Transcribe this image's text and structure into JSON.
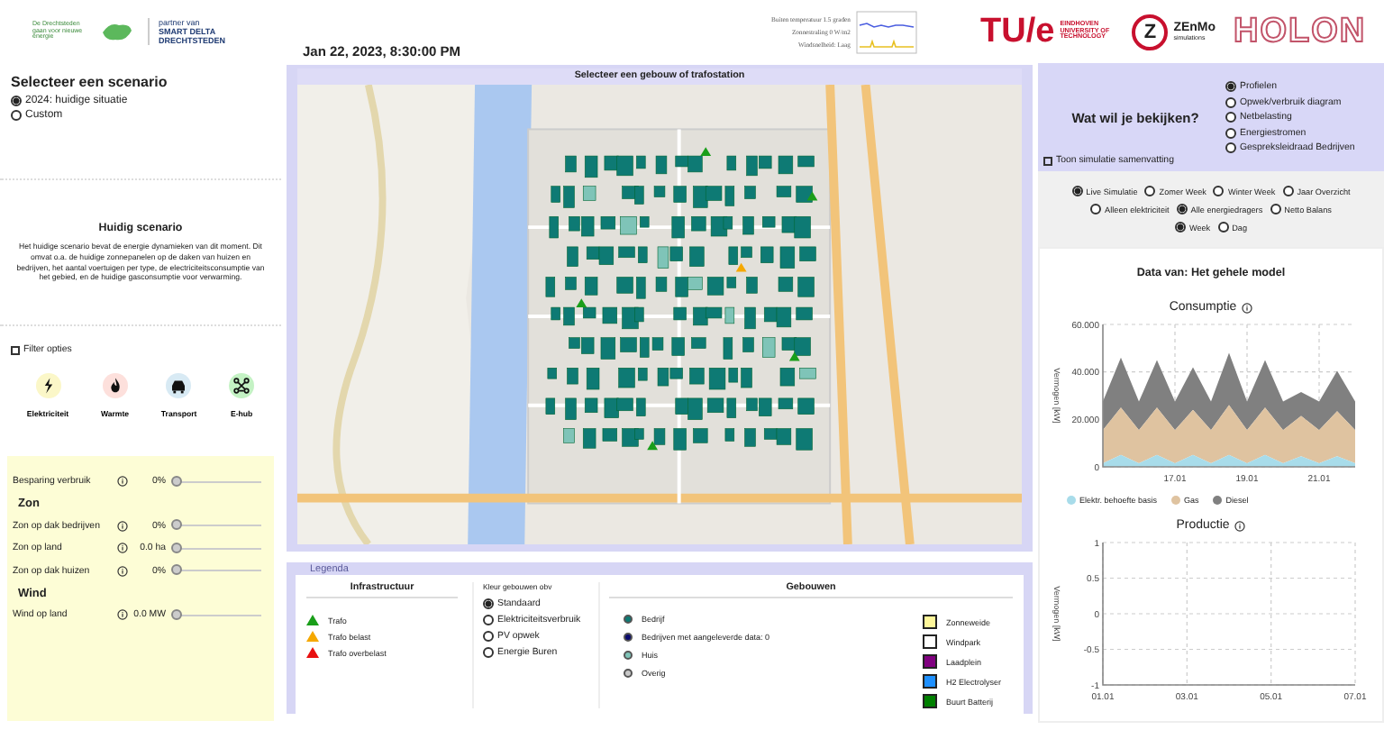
{
  "header": {
    "logo_left": "De Drechtsteden gaan voor nieuwe energie",
    "partner": {
      "caption": "partner van",
      "name": "SMART DELTA DRECHTSTEDEN"
    },
    "datetime": "Jan 22, 2023, 8:30:00 PM",
    "weather": [
      "Buiten temperatuur 1.5 graden",
      "Zonnestraling 0 W/m2",
      "Windsnelheid: Laag"
    ],
    "logos": [
      {
        "kind": "tue",
        "mark": "TU/e",
        "text": "EINDHOVEN UNIVERSITY OF TECHNOLOGY"
      },
      {
        "kind": "zenmo",
        "mark": "Z",
        "text": "ZEnMo",
        "sub": "simulations"
      },
      {
        "kind": "holon",
        "text": "HOLON"
      }
    ]
  },
  "scenario": {
    "title": "Selecteer een scenario",
    "options": [
      {
        "label": "2024: huidige situatie",
        "selected": true
      },
      {
        "label": "Custom",
        "selected": false
      }
    ]
  },
  "description": {
    "title": "Huidig scenario",
    "text": "Het huidige scenario bevat de energie dynamieken van dit moment. Dit omvat o.a. de huidige zonnepanelen op de daken van huizen en bedrijven, het aantal voertuigen per type, de electriciteitsconsumptie van het gebied, en de huidige gasconsumptie voor verwarming."
  },
  "filter": {
    "label": "Filter opties",
    "checked": false
  },
  "categories": [
    {
      "kind": "electricity",
      "label": "Elektriciteit",
      "color": "#fbf7c8"
    },
    {
      "kind": "heat",
      "label": "Warmte",
      "color": "#fde0dc"
    },
    {
      "kind": "transport",
      "label": "Transport",
      "color": "#d8eaf4"
    },
    {
      "kind": "ehub",
      "label": "E-hub",
      "color": "#c4f2c4"
    }
  ],
  "sliders": [
    {
      "kind": "slider",
      "label": "Besparing verbruik",
      "value": "0%",
      "level": 0
    },
    {
      "kind": "heading",
      "label": "Zon"
    },
    {
      "kind": "slider",
      "label": "Zon op dak bedrijven",
      "value": "0%",
      "level": 0
    },
    {
      "kind": "slider",
      "label": "Zon op land",
      "value": "0.0 ha",
      "level": 0
    },
    {
      "kind": "slider",
      "label": "Zon op dak huizen",
      "value": "0%",
      "level": 0
    },
    {
      "kind": "heading",
      "label": "Wind"
    },
    {
      "kind": "slider",
      "label": "Wind op land",
      "value": "0.0 MW",
      "level": 0
    }
  ],
  "map": {
    "title": "Selecteer een gebouw of trafostation"
  },
  "legend": {
    "title": "Legenda",
    "infra": {
      "title": "Infrastructuur",
      "items": [
        {
          "label": "Trafo",
          "color": "#1a9e1a"
        },
        {
          "label": "Trafo belast",
          "color": "#f5a800"
        },
        {
          "label": "Trafo overbelast",
          "color": "#e81010"
        }
      ]
    },
    "color_by": {
      "title": "Kleur gebouwen obv",
      "options": [
        {
          "label": "Standaard",
          "selected": true
        },
        {
          "label": "Elektriciteitsverbruik",
          "selected": false
        },
        {
          "label": "PV opwek",
          "selected": false
        },
        {
          "label": "Energie Buren",
          "selected": false
        }
      ]
    },
    "buildings": {
      "title": "Gebouwen",
      "types": [
        {
          "label": "Bedrijf",
          "color": "#0e7a74"
        },
        {
          "label": "Bedrijven met aangeleverde data: 0",
          "color": "#0a0a6e"
        },
        {
          "label": "Huis",
          "color": "#7fc4b8"
        },
        {
          "label": "Overig",
          "color": "#c8c8c8"
        }
      ],
      "assets": [
        {
          "label": "Zonneweide",
          "color": "#fff79a"
        },
        {
          "label": "Windpark",
          "color": "#ffffff"
        },
        {
          "label": "Laadplein",
          "color": "#800080"
        },
        {
          "label": "H2 Electrolyser",
          "color": "#1e90ff"
        },
        {
          "label": "Buurt Batterij",
          "color": "#008000"
        }
      ]
    }
  },
  "view": {
    "title": "Wat wil je bekijken?",
    "options": [
      {
        "label": "Profielen",
        "selected": true
      },
      {
        "label": "Opwek/verbruik diagram",
        "selected": false
      },
      {
        "label": "Netbelasting",
        "selected": false
      },
      {
        "label": "Energiestromen",
        "selected": false
      },
      {
        "label": "Gespreksleidraad Bedrijven",
        "selected": false
      }
    ],
    "summary": {
      "label": "Toon simulatie samenvatting",
      "checked": false
    }
  },
  "mode_groups": [
    {
      "options": [
        {
          "label": "Live Simulatie",
          "selected": true
        },
        {
          "label": "Zomer Week",
          "selected": false
        },
        {
          "label": "Winter Week",
          "selected": false
        },
        {
          "label": "Jaar Overzicht",
          "selected": false
        }
      ]
    },
    {
      "options": [
        {
          "label": "Alleen elektriciteit",
          "selected": false
        },
        {
          "label": "Alle energiedragers",
          "selected": true
        },
        {
          "label": "Netto Balans",
          "selected": false
        }
      ]
    },
    {
      "options": [
        {
          "label": "Week",
          "selected": true
        },
        {
          "label": "Dag",
          "selected": false
        }
      ]
    }
  ],
  "results": {
    "title": "Data van: Het gehele model",
    "charts": [
      {
        "chart_data": {
          "type": "area",
          "stacked": true,
          "title": "Consumptie",
          "ylabel": "Vermogen [kW]",
          "categories": [
            null,
            null,
            null,
            null,
            "17.01",
            null,
            null,
            null,
            "19.01",
            null,
            null,
            null,
            "21.01",
            null,
            null
          ],
          "series": [
            {
              "name": "Elektr. behoefte basis",
              "color": "#a8dcea",
              "values": [
                1.5,
                5,
                1.5,
                5,
                1.5,
                5,
                1.5,
                5,
                1.5,
                5,
                1.5,
                4.5,
                1.5,
                4.5,
                1.5
              ]
            },
            {
              "name": "Gas",
              "color": "#dfc3a0",
              "values": [
                14,
                20,
                14,
                20,
                14,
                19,
                14,
                21,
                14,
                20,
                14,
                17,
                14,
                19,
                14
              ]
            },
            {
              "name": "Diesel",
              "color": "#808080",
              "values": [
                12,
                21,
                12,
                20,
                12,
                18,
                12,
                22,
                12,
                20,
                12,
                10,
                12,
                17,
                12
              ]
            }
          ],
          "ylim": [
            0,
            60
          ],
          "grid": true,
          "yticks": [
            {
              "value": 0,
              "label": "0"
            },
            {
              "value": 20,
              "label": "20.000"
            },
            {
              "value": 40,
              "label": "40.000"
            },
            {
              "value": 60,
              "label": "60.000"
            }
          ]
        }
      },
      {
        "chart_data": {
          "type": "line",
          "title": "Productie",
          "ylabel": "Vermogen [kW]",
          "categories": [
            "01.01",
            null,
            "03.01",
            null,
            "05.01",
            null,
            "07.01"
          ],
          "ylim": [
            -1,
            1
          ],
          "grid": true,
          "yticks": [
            -1,
            -0.5,
            0,
            0.5,
            1
          ]
        }
      }
    ]
  }
}
